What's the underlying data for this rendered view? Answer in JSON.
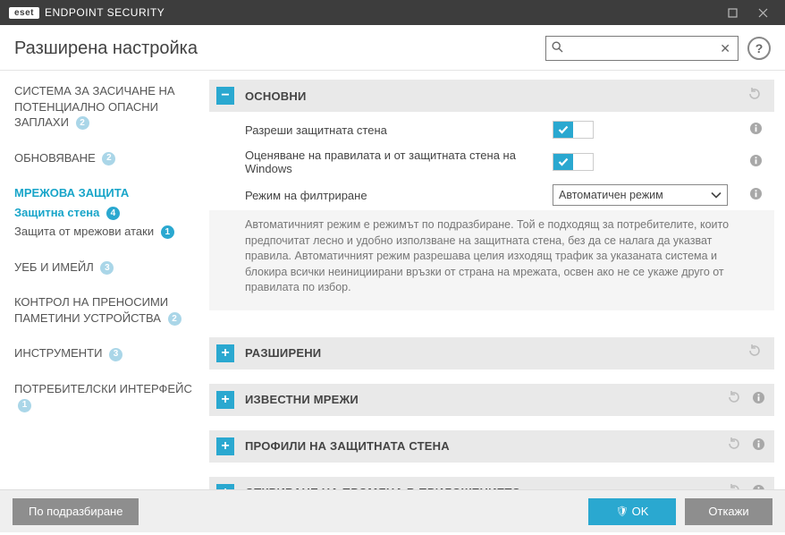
{
  "titlebar": {
    "brand_box": "eset",
    "brand_name": "ENDPOINT SECURITY"
  },
  "header": {
    "title": "Разширена настройка",
    "search_placeholder": "",
    "help": "?"
  },
  "sidebar": [
    {
      "label": "СИСТЕМА ЗА ЗАСИЧАНЕ НА ПОТЕНЦИАЛНО ОПАСНИ ЗАПЛАХИ",
      "badge": "2",
      "active": false,
      "subs": []
    },
    {
      "label": "ОБНОВЯВАНЕ",
      "badge": "2",
      "active": false,
      "subs": []
    },
    {
      "label": "МРЕЖОВА ЗАЩИТА",
      "badge": "",
      "active": true,
      "subs": [
        {
          "label": "Защитна стена",
          "badge": "4",
          "active": true
        },
        {
          "label": "Защита от мрежови атаки",
          "badge": "1",
          "active": false
        }
      ]
    },
    {
      "label": "УЕБ И ИМЕЙЛ",
      "badge": "3",
      "active": false,
      "subs": []
    },
    {
      "label": "КОНТРОЛ НА ПРЕНОСИМИ ПАМЕТИНИ УСТРОЙСТВА",
      "badge": "2",
      "active": false,
      "subs": []
    },
    {
      "label": "ИНСТРУМЕНТИ",
      "badge": "3",
      "active": false,
      "subs": []
    },
    {
      "label": "ПОТРЕБИТЕЛСКИ ИНТЕРФЕЙС",
      "badge": "1",
      "active": false,
      "subs": []
    }
  ],
  "sections": {
    "main": {
      "title": "ОСНОВНИ",
      "expanded": true,
      "rows": [
        {
          "label": "Разреши защитната стена",
          "toggle_on": true
        },
        {
          "label": "Оценяване на правилата и от защитната стена на Windows",
          "toggle_on": true
        },
        {
          "label": "Режим на филтриране",
          "select_value": "Автоматичен режим"
        }
      ],
      "description": "Автоматичният режим е режимът по подразбиране. Той е подходящ за потребителите, които предпочитат лесно и удобно използване на защитната стена, без да се налага да указват правила. Автоматичният режим разрешава целия изходящ трафик за указаната система и блокира всички неинициирани връзки от страна на мрежата, освен ако не се укаже друго от правилата по избор."
    },
    "collapsed": [
      {
        "title": "РАЗШИРЕНИ",
        "has_info": false
      },
      {
        "title": "ИЗВЕСТНИ МРЕЖИ",
        "has_info": true
      },
      {
        "title": "ПРОФИЛИ НА ЗАЩИТНАТА СТЕНА",
        "has_info": true
      },
      {
        "title": "ОТКРИВАНЕ НА ПРОМЯНА В ПРИЛОЖЕНИЕТО",
        "has_info": true
      }
    ]
  },
  "footer": {
    "default": "По подразбиране",
    "ok": "OK",
    "cancel": "Откажи"
  }
}
